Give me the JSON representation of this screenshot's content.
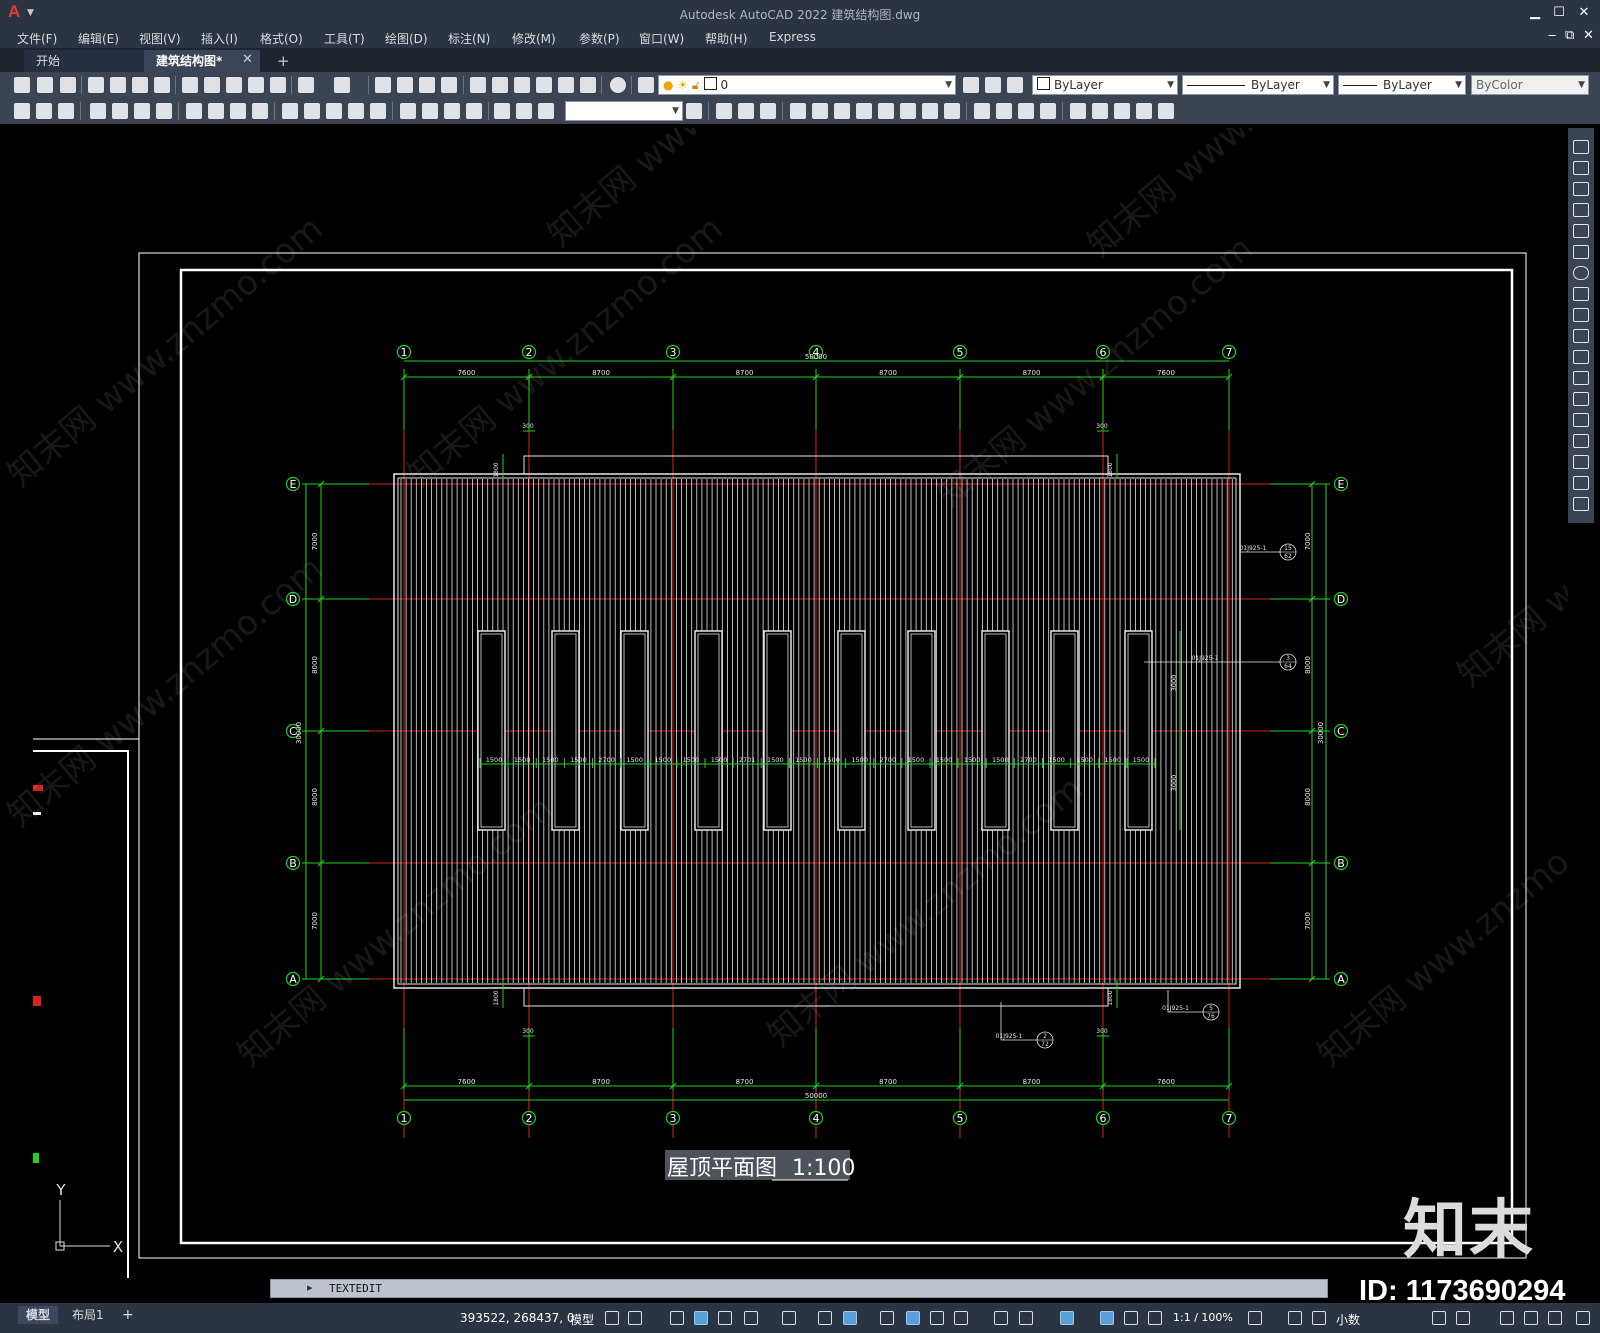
{
  "app": {
    "logo": "A",
    "window_title": "Autodesk AutoCAD 2022     建筑结构图.dwg"
  },
  "window_controls": {
    "minimize": "▁",
    "maximize": "☐",
    "close": "✕",
    "doc_minimize": "‒",
    "doc_restore": "⧉",
    "doc_close": "✕"
  },
  "menu": [
    "文件(F)",
    "编辑(E)",
    "视图(V)",
    "插入(I)",
    "格式(O)",
    "工具(T)",
    "绘图(D)",
    "标注(N)",
    "修改(M)",
    "参数(P)",
    "窗口(W)",
    "帮助(H)",
    "Express"
  ],
  "tabs": {
    "start": "开始",
    "drawing": "建筑结构图*",
    "close": "✕",
    "add": "+"
  },
  "toolbar": {
    "layer_value": "0",
    "color": "ByLayer",
    "linetype": "ByLayer",
    "lineweight": "ByLayer",
    "plot_style": "ByColor",
    "blank_combo": ""
  },
  "drawing": {
    "grid_numbers": [
      "1",
      "2",
      "3",
      "4",
      "5",
      "6",
      "7"
    ],
    "grid_letters": [
      "E",
      "D",
      "C",
      "B",
      "A"
    ],
    "top_total": "50000",
    "bottom_total": "50000",
    "span_dims": [
      "7600",
      "8700",
      "8700",
      "8700",
      "8700",
      "7600"
    ],
    "offset_300": "300",
    "offset_1800": "1800",
    "left_dims": [
      "7000",
      "8000",
      "8000",
      "7000"
    ],
    "left_total": "30000",
    "right_dims": [
      "7000",
      "8000",
      "8000",
      "7000"
    ],
    "right_total": "30000",
    "skylight_dims": [
      "1500",
      "1500",
      "1500",
      "1500",
      "2700",
      "1500",
      "1500",
      "1500",
      "1500",
      "2701",
      "1500",
      "1500",
      "1500",
      "1500",
      "2700",
      "1500",
      "1500",
      "1500",
      "1500",
      "2700",
      "1500",
      "1500",
      "1500",
      "1500"
    ],
    "skylight_height_a": "3000",
    "skylight_height_b": "3000",
    "detail_ref_1": "01J925-1",
    "detail_ref_1_num": "15",
    "detail_ref_1_sheet": "62",
    "detail_ref_2": "01J925-1",
    "detail_ref_2_num": "3",
    "detail_ref_2_sheet": "64",
    "detail_ref_3": "01J925-1",
    "detail_ref_3_num": "5",
    "detail_ref_3_sheet": "76",
    "detail_ref_4": "01J925-1",
    "detail_ref_4_num": "2",
    "detail_ref_4_sheet": "72",
    "title": "屋顶平面图",
    "scale": "1:100",
    "ucs_y": "Y",
    "ucs_x": "X",
    "watermark": "知末网 www.znzmo.com"
  },
  "command_line": {
    "prompt": "▸",
    "text": "TEXTEDIT"
  },
  "status": {
    "model_tab": "模型",
    "layout_tab": "布局1",
    "add_tab": "+",
    "coords": "393522, 268437, 0",
    "model_space": "模型",
    "scale": "1:1 / 100%",
    "units": "小数"
  },
  "watermark": {
    "logo": "知末",
    "id": "ID: 1173690294"
  },
  "colors": {
    "background": "#000000",
    "grid_green": "#1fd41f",
    "axis_red": "#d42020",
    "roof_white": "#e6e6e6",
    "ui_dark": "#2b3442",
    "toolbar": "#3b4453"
  }
}
